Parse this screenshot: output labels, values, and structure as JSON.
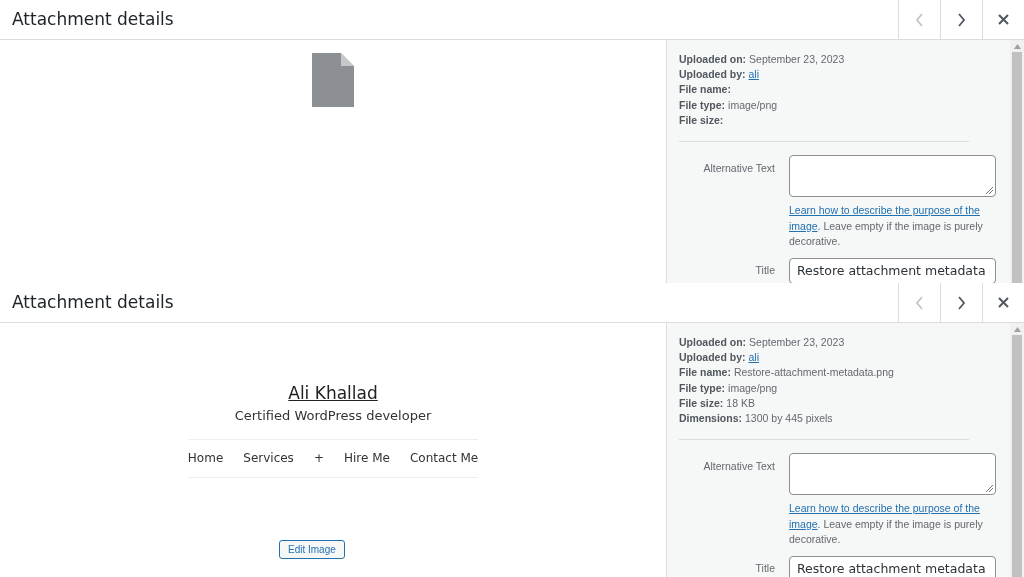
{
  "panels": [
    {
      "title": "Attachment details",
      "nav": {
        "previous_disabled": true,
        "next_disabled": false
      },
      "preview": {
        "kind": "file-icon"
      },
      "details": [
        {
          "label": "Uploaded on:",
          "value": "September 23, 2023"
        },
        {
          "label": "Uploaded by:",
          "value": "ali",
          "kind": "link"
        },
        {
          "label": "File name:"
        },
        {
          "label": "File type:",
          "value": "image/png"
        },
        {
          "label": "File size:"
        }
      ],
      "alt_text": {
        "label": "Alternative Text",
        "link_lines": [
          "Learn how to describe the purpose of the",
          "image"
        ],
        "note": ". Leave empty if the image is purely decorative."
      },
      "title_field": {
        "label": "Title",
        "value": "Restore attachment metadata"
      }
    },
    {
      "title": "Attachment details",
      "nav": {
        "previous_disabled": true,
        "next_disabled": false
      },
      "preview": {
        "kind": "site",
        "site_title": "Ali Khallad",
        "tagline": "Certified WordPress developer",
        "menu": [
          "Home",
          "Services",
          "+",
          "Hire Me",
          "Contact Me"
        ],
        "button": "Edit Image"
      },
      "details": [
        {
          "label": "Uploaded on:",
          "value": "September 23, 2023"
        },
        {
          "label": "Uploaded by:",
          "value": "ali",
          "kind": "link"
        },
        {
          "label": "File name:",
          "value": "Restore-attachment-metadata.png"
        },
        {
          "label": "File type:",
          "value": "image/png"
        },
        {
          "label": "File size:",
          "value": "18 KB"
        },
        {
          "label": "Dimensions:",
          "value": "1300 by 445 pixels"
        }
      ],
      "alt_text": {
        "label": "Alternative Text",
        "link_lines": [
          "Learn how to describe the purpose of the",
          "image"
        ],
        "note": ". Leave empty if the image is purely decorative."
      },
      "title_field": {
        "label": "Title",
        "value": "Restore attachment metadata"
      }
    }
  ]
}
